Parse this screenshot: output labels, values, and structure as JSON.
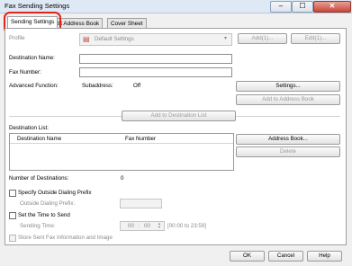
{
  "window": {
    "title": "Fax Sending Settings",
    "minimize": "–",
    "maximize": "☐",
    "close": "✕"
  },
  "tabs": [
    {
      "label": "Sending Settings"
    },
    {
      "label": "Edit Address Book"
    },
    {
      "label": "Cover Sheet"
    }
  ],
  "profile": {
    "label": "Profile",
    "value": "Default Settings",
    "add_label": "Add(1)...",
    "edit_label": "Edit(1)..."
  },
  "destination": {
    "name_label": "Destination Name:",
    "name_value": "",
    "number_label": "Fax Number:",
    "number_value": ""
  },
  "advanced": {
    "label": "Advanced Function:",
    "subaddress_label": "Subaddress:",
    "subaddress_value": "Off",
    "settings_label": "Settings...",
    "add_to_address_book_label": "Add to Address Book"
  },
  "add_to_list_label": "Add to Destination List",
  "destination_list": {
    "label": "Destination List:",
    "columns": [
      "Destination Name",
      "Fax Number"
    ],
    "address_book_label": "Address Book...",
    "delete_label": "Delete"
  },
  "num_destinations": {
    "label": "Number of Destinations:",
    "value": "0"
  },
  "outside_prefix": {
    "checkbox_label": "Specify Outside Dialing Prefix",
    "field_label": "Outside Dialing Prefix:",
    "value": ""
  },
  "send_time": {
    "checkbox_label": "Set the Time to Send",
    "field_label": "Sending Time:",
    "hours": "00",
    "minutes": "00",
    "range_label": "[00:00 to 23:59]"
  },
  "store_label": "Store Sent Fax Information and Image",
  "footer": {
    "ok": "OK",
    "cancel": "Cancel",
    "help": "Help"
  }
}
